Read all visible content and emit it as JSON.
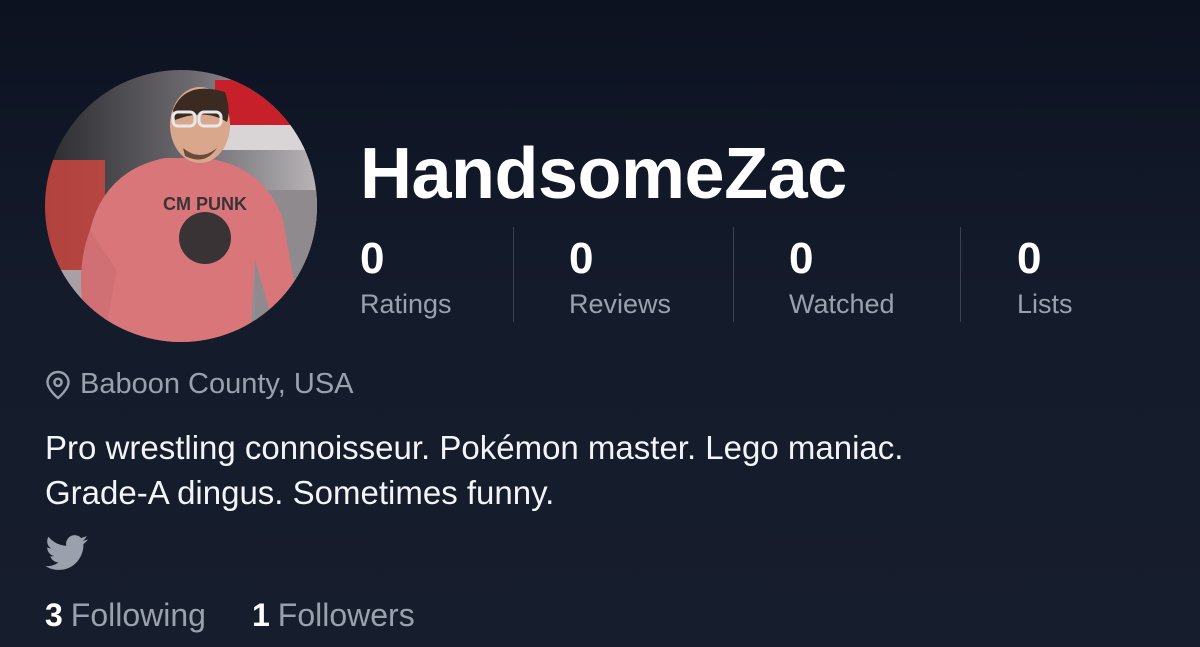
{
  "profile": {
    "username": "HandsomeZac",
    "location": "Baboon County, USA",
    "bio_lines": [
      "Pro wrestling connoisseur. Pokémon master. Lego maniac.",
      "Grade-A dingus. Sometimes funny."
    ],
    "avatar_shirt_text": "CM PUNK"
  },
  "stats": [
    {
      "value": "0",
      "label": "Ratings"
    },
    {
      "value": "0",
      "label": "Reviews"
    },
    {
      "value": "0",
      "label": "Watched"
    },
    {
      "value": "0",
      "label": "Lists"
    }
  ],
  "social": {
    "following_count": "3",
    "following_label": "Following",
    "followers_count": "1",
    "followers_label": "Followers"
  },
  "icons": {
    "location": "map-pin-icon",
    "twitter": "twitter-icon"
  },
  "colors": {
    "background": "#141b2b",
    "muted_text": "#9aa1ad",
    "divider": "#3a4253"
  }
}
